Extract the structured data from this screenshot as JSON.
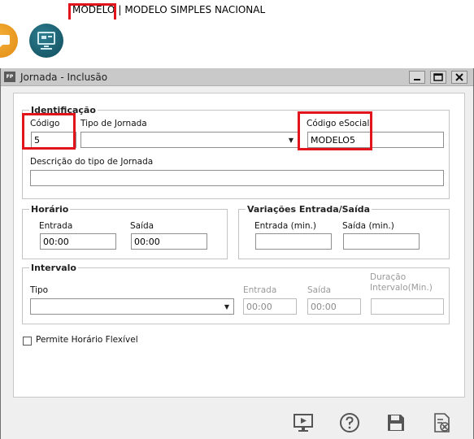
{
  "header": {
    "model_label": "MODELO",
    "separator": "|",
    "model_name": "MODELO SIMPLES NACIONAL"
  },
  "window": {
    "icon_text": "FP",
    "title": "Jornada - Inclusão",
    "minimize_glyph": "▁",
    "maximize_glyph": "▭",
    "close_glyph": "✕"
  },
  "identificacao": {
    "legend": "Identificação",
    "codigo_label": "Código",
    "codigo_value": "5",
    "tipo_label": "Tipo de Jornada",
    "tipo_value": "",
    "esocial_label": "Código eSocial",
    "esocial_value": "MODELO5",
    "descricao_label": "Descrição do tipo de Jornada",
    "descricao_value": ""
  },
  "horario": {
    "legend": "Horário",
    "entrada_label": "Entrada",
    "entrada_value": "00:00",
    "saida_label": "Saída",
    "saida_value": "00:00"
  },
  "variacoes": {
    "legend": "Variações Entrada/Saída",
    "entrada_label": "Entrada (min.)",
    "entrada_value": "",
    "saida_label": "Saída (min.)",
    "saida_value": ""
  },
  "intervalo": {
    "legend": "Intervalo",
    "tipo_label": "Tipo",
    "tipo_value": "",
    "entrada_label": "Entrada",
    "entrada_value": "00:00",
    "saida_label": "Saída",
    "saida_value": "00:00",
    "duracao_label_1": "Duração",
    "duracao_label_2": "Intervalo(Min.)",
    "duracao_value": ""
  },
  "flexivel": {
    "label": "Permite Horário Flexível",
    "checked": false
  },
  "icons": {
    "app1": "orange-app-icon",
    "app2": "teal-app-icon",
    "toolbar": [
      "presentation-icon",
      "help-icon",
      "save-icon",
      "cancel-icon"
    ]
  },
  "colors": {
    "highlight": "#e1141c",
    "titlebar": "#c9c9c9",
    "window_bg": "#efefef",
    "panel_bg": "#ffffff"
  }
}
